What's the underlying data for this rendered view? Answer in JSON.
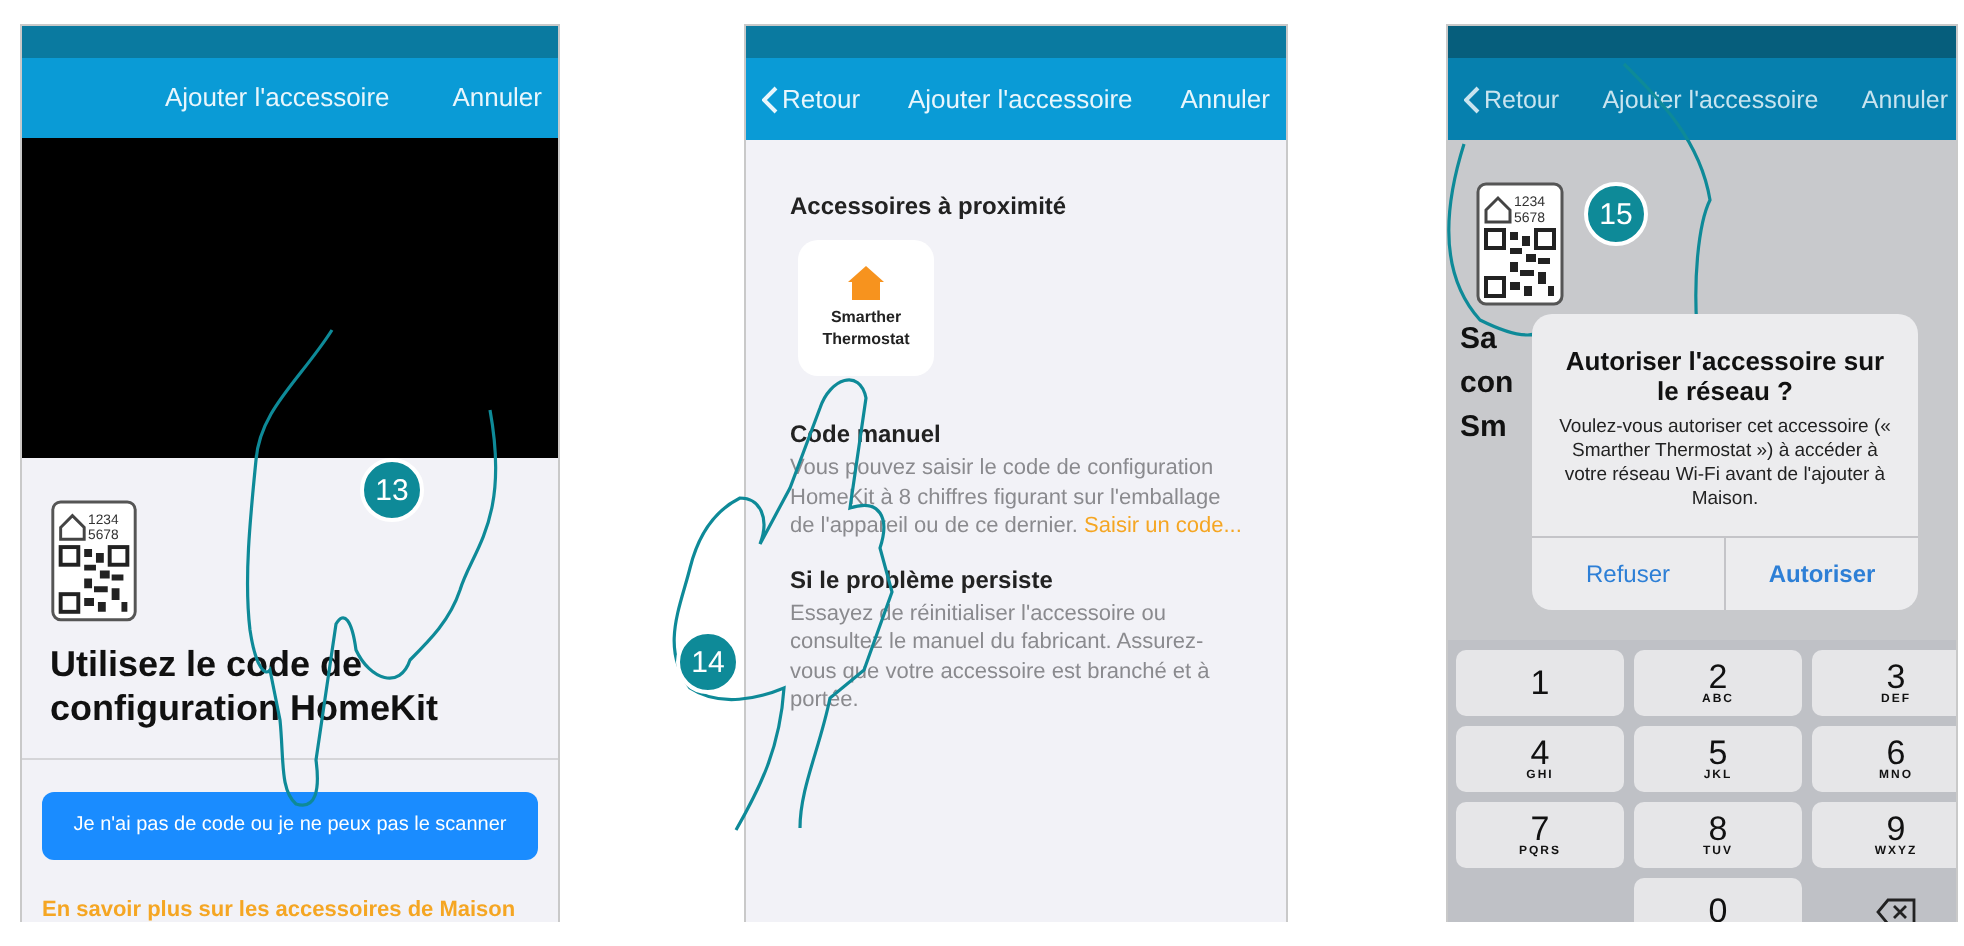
{
  "scan_screen": {
    "nav": {
      "title": "Ajouter l'accessoire",
      "cancel": "Annuler"
    },
    "qr_label": [
      "1234",
      "5678"
    ],
    "heading": "Utilisez le code de configuration HomeKit",
    "button": "Je n'ai pas de code ou je ne peux pas le scanner",
    "link": "En savoir plus sur les accessoires de Maison",
    "step": "13"
  },
  "nearby_screen": {
    "nav": {
      "back": "Retour",
      "title": "Ajouter l'accessoire",
      "cancel": "Annuler"
    },
    "section": "Accessoires à proximité",
    "accessory": "Smarther Thermostat",
    "manual_title": "Code manuel",
    "manual_text": "Vous pouvez saisir le code de configuration HomeKit à 8 chiffres figurant sur l'emballage de l'appareil ou de ce dernier.",
    "manual_link": "Saisir un code...",
    "problem_title": "Si le problème persiste",
    "problem_text": "Essayez de réinitialiser l'accessoire ou consultez le manuel du fabricant. Assurez-vous que votre accessoire est branché et à portée.",
    "step": "14"
  },
  "permission_screen": {
    "nav": {
      "back": "Retour",
      "title": "Ajouter l'accessoire",
      "cancel": "Annuler"
    },
    "qr_label": [
      "1234",
      "5678"
    ],
    "heading_lines": [
      "Sa",
      "con",
      "Sm"
    ],
    "dialog": {
      "title": "Autoriser l'accessoire sur le réseau ?",
      "message": "Voulez-vous autoriser cet accessoire (« Smarther Thermostat ») à accéder à votre réseau Wi-Fi avant de l'ajouter à Maison.",
      "buttons": [
        {
          "label": "Refuser",
          "bold": false
        },
        {
          "label": "Autoriser",
          "bold": true
        }
      ]
    },
    "keys": [
      {
        "kind": "digit",
        "digit": "1"
      },
      {
        "kind": "digit",
        "digit": "2",
        "letters": "ABC"
      },
      {
        "kind": "digit",
        "digit": "3",
        "letters": "DEF"
      },
      {
        "kind": "digit",
        "digit": "4",
        "letters": "GHI"
      },
      {
        "kind": "digit",
        "digit": "5",
        "letters": "JKL"
      },
      {
        "kind": "digit",
        "digit": "6",
        "letters": "MNO"
      },
      {
        "kind": "digit",
        "digit": "7",
        "letters": "PQRS"
      },
      {
        "kind": "digit",
        "digit": "8",
        "letters": "TUV"
      },
      {
        "kind": "digit",
        "digit": "9",
        "letters": "WXYZ"
      },
      {
        "kind": "blank"
      },
      {
        "kind": "digit",
        "digit": "0"
      },
      {
        "kind": "delete"
      }
    ],
    "step": "15"
  }
}
